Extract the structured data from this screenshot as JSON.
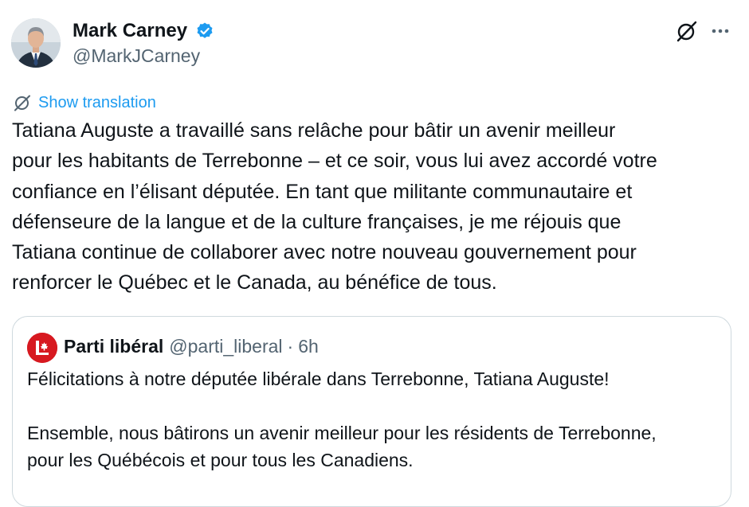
{
  "author": {
    "name": "Mark Carney",
    "handle": "@MarkJCarney",
    "verified": true
  },
  "actions": {
    "translate_label": "Show translation"
  },
  "tweet": {
    "text": "Tatiana Auguste a travaillé sans relâche pour bâtir un avenir meilleur\npour les habitants de Terrebonne – et ce soir, vous lui avez accordé votre\nconfiance en l’élisant députée. En tant que militante communautaire et\ndéfenseure de la langue et de la culture françaises, je me réjouis que\nTatiana continue de collaborer avec notre nouveau gouvernement pour\nrenforcer le Québec et le Canada, au bénéfice de tous."
  },
  "quote": {
    "name": "Parti libéral",
    "handle": "@parti_liberal",
    "separator": "·",
    "time": "6h",
    "text": "Félicitations à notre députée libérale dans Terrebonne, Tatiana Auguste!\n\nEnsemble, nous bâtirons un avenir meilleur pour les résidents de Terrebonne,\npour les Québécois et pour tous les Canadiens."
  },
  "icons": {
    "verified": "verified-badge-icon",
    "grok": "grok-icon",
    "more": "more-icon",
    "translate": "translate-icon"
  },
  "colors": {
    "accent": "#1d9bf0",
    "secondary_text": "#536471",
    "primary_text": "#0f1419",
    "border": "#cfd9de",
    "liberal_red": "#d71920"
  }
}
